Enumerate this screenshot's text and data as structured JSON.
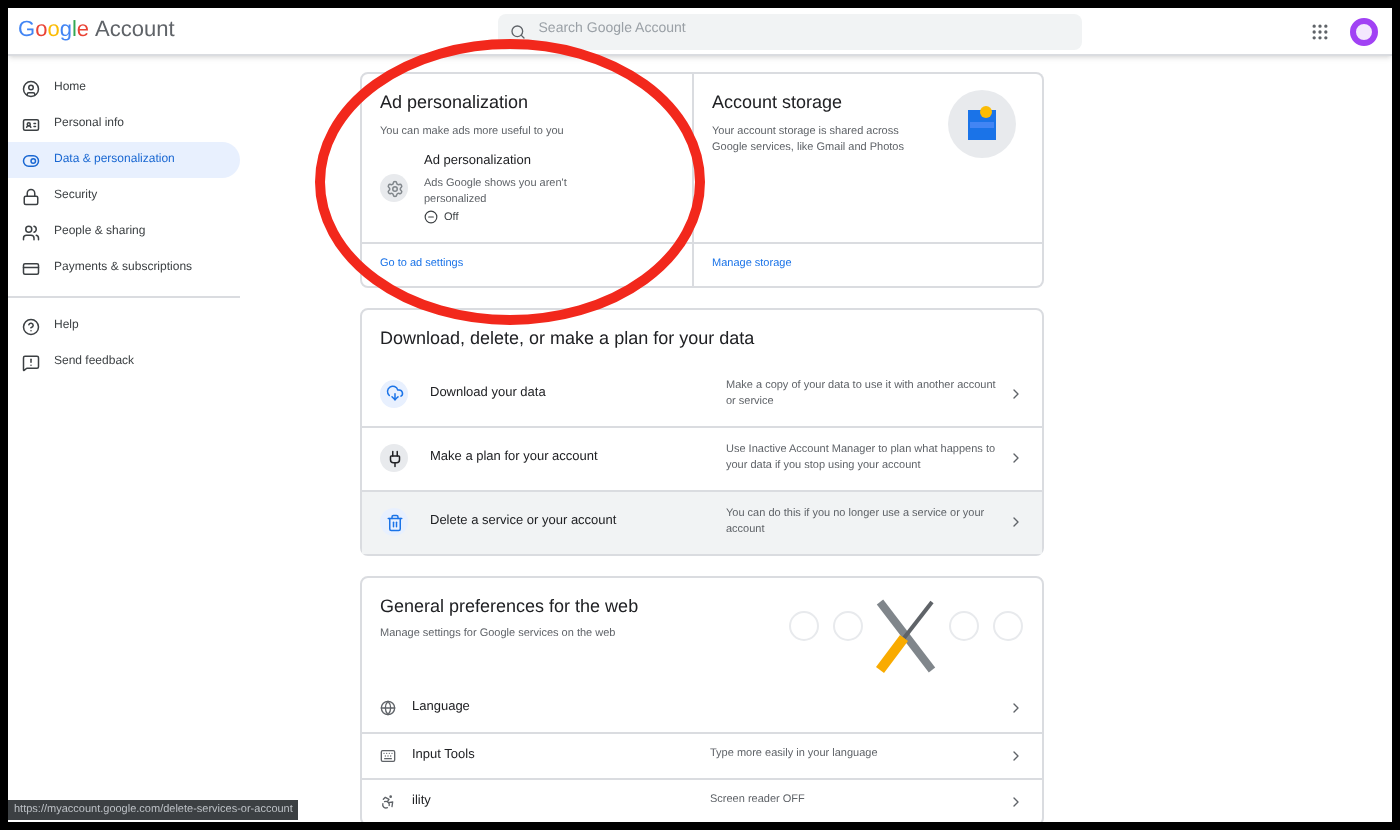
{
  "header": {
    "logo": "Google",
    "product": "Account",
    "search": {
      "placeholder": "Search Google Account"
    }
  },
  "sidebar": {
    "items": [
      {
        "label": "Home",
        "selected": false
      },
      {
        "label": "Personal info",
        "selected": false
      },
      {
        "label": "Data & personalization",
        "selected": true
      },
      {
        "label": "Security",
        "selected": false
      },
      {
        "label": "People & sharing",
        "selected": false
      },
      {
        "label": "Payments & subscriptions",
        "selected": false
      }
    ],
    "secondary": [
      {
        "label": "Help"
      },
      {
        "label": "Send feedback"
      }
    ]
  },
  "ad_card": {
    "title": "Ad personalization",
    "subtitle": "You can make ads more useful to you",
    "setting": {
      "title": "Ad personalization",
      "description": "Ads Google shows you aren't personalized",
      "on": false,
      "status": "Off"
    },
    "link": "Go to ad settings"
  },
  "storage_card": {
    "title": "Account storage",
    "description": "Your account storage is shared across Google services, like Gmail and Photos",
    "link": "Manage storage"
  },
  "data_card": {
    "title": "Download, delete, or make a plan for your data",
    "rows": [
      {
        "label": "Download your data",
        "description": "Make a copy of your data to use it with another account or service",
        "highlighted": false
      },
      {
        "label": "Make a plan for your account",
        "description": "Use Inactive Account Manager to plan what happens to your data if you stop using your account",
        "highlighted": false
      },
      {
        "label": "Delete a service or your account",
        "description": "You can do this if you no longer use a service or your account",
        "highlighted": true
      }
    ]
  },
  "prefs_card": {
    "title": "General preferences for the web",
    "subtitle": "Manage settings for Google services on the web",
    "rows": [
      {
        "label": "Language"
      },
      {
        "label": "Input Tools",
        "description": "Type more easily in your language"
      },
      {
        "label": "ility",
        "description": "Screen reader OFF"
      }
    ]
  },
  "status_bar": {
    "url": "https://myaccount.google.com/delete-services-or-account"
  }
}
